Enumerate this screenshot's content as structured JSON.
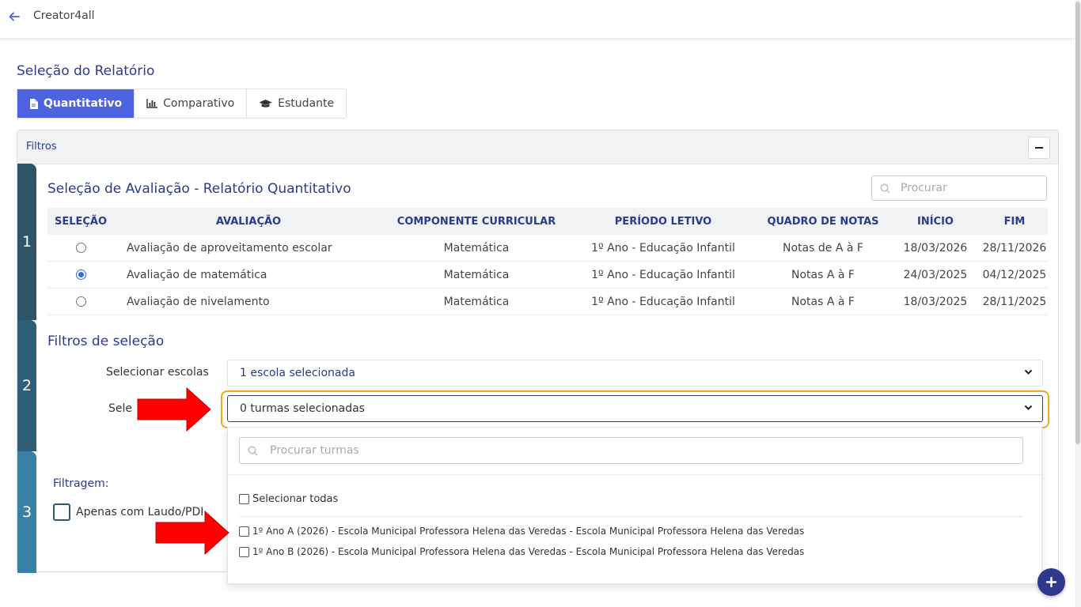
{
  "app": {
    "title": "Creator4all"
  },
  "page": {
    "title": "Seleção do Relatório"
  },
  "tabs": [
    {
      "label": "Quantitativo",
      "icon": "document-icon",
      "active": true
    },
    {
      "label": "Comparativo",
      "icon": "bar-chart-icon",
      "active": false
    },
    {
      "label": "Estudante",
      "icon": "graduation-cap-icon",
      "active": false
    }
  ],
  "panel": {
    "title": "Filtros"
  },
  "steps": [
    "1",
    "2",
    "3"
  ],
  "evaluation": {
    "title": "Seleção de Avaliação - Relatório Quantitativo",
    "search_placeholder": "Procurar",
    "columns": [
      "SELEÇÃO",
      "AVALIAÇÃO",
      "COMPONENTE CURRICULAR",
      "PERÍODO LETIVO",
      "QUADRO DE NOTAS",
      "INÍCIO",
      "FIM"
    ],
    "rows": [
      {
        "selected": false,
        "name": "Avaliação de aproveitamento escolar",
        "component": "Matemática",
        "period": "1º Ano - Educação Infantil",
        "grades": "Notas de A à F",
        "start": "18/03/2026",
        "end": "28/11/2026"
      },
      {
        "selected": true,
        "name": "Avaliação de matemática",
        "component": "Matemática",
        "period": "1º Ano - Educação Infantil",
        "grades": "Notas A à F",
        "start": "24/03/2025",
        "end": "04/12/2025"
      },
      {
        "selected": false,
        "name": "Avaliação de nivelamento",
        "component": "Matemática",
        "period": "1º Ano - Educação Infantil",
        "grades": "Notas A à F",
        "start": "18/03/2025",
        "end": "28/11/2025"
      }
    ]
  },
  "filters": {
    "title": "Filtros de seleção",
    "schools_label": "Selecionar escolas",
    "schools_value": "1 escola selecionada",
    "classes_label": "Sele",
    "classes_value": "0 turmas selecionadas"
  },
  "filtering": {
    "title": "Filtragem:",
    "laudo_label": "Apenas com Laudo/PDI"
  },
  "dropdown": {
    "search_placeholder": "Procurar turmas",
    "select_all": "Selecionar todas",
    "options": [
      "1º Ano A (2026) - Escola Municipal Professora Helena das Veredas - Escola Municipal Professora Helena das Veredas",
      "1º Ano B (2026) - Escola Municipal Professora Helena das Veredas - Escola Municipal Professora Helena das Veredas"
    ]
  },
  "colors": {
    "primary": "#4d63e0",
    "navy": "#2c3a8c",
    "highlight": "#f2a81c",
    "arrow": "#ff0000"
  }
}
